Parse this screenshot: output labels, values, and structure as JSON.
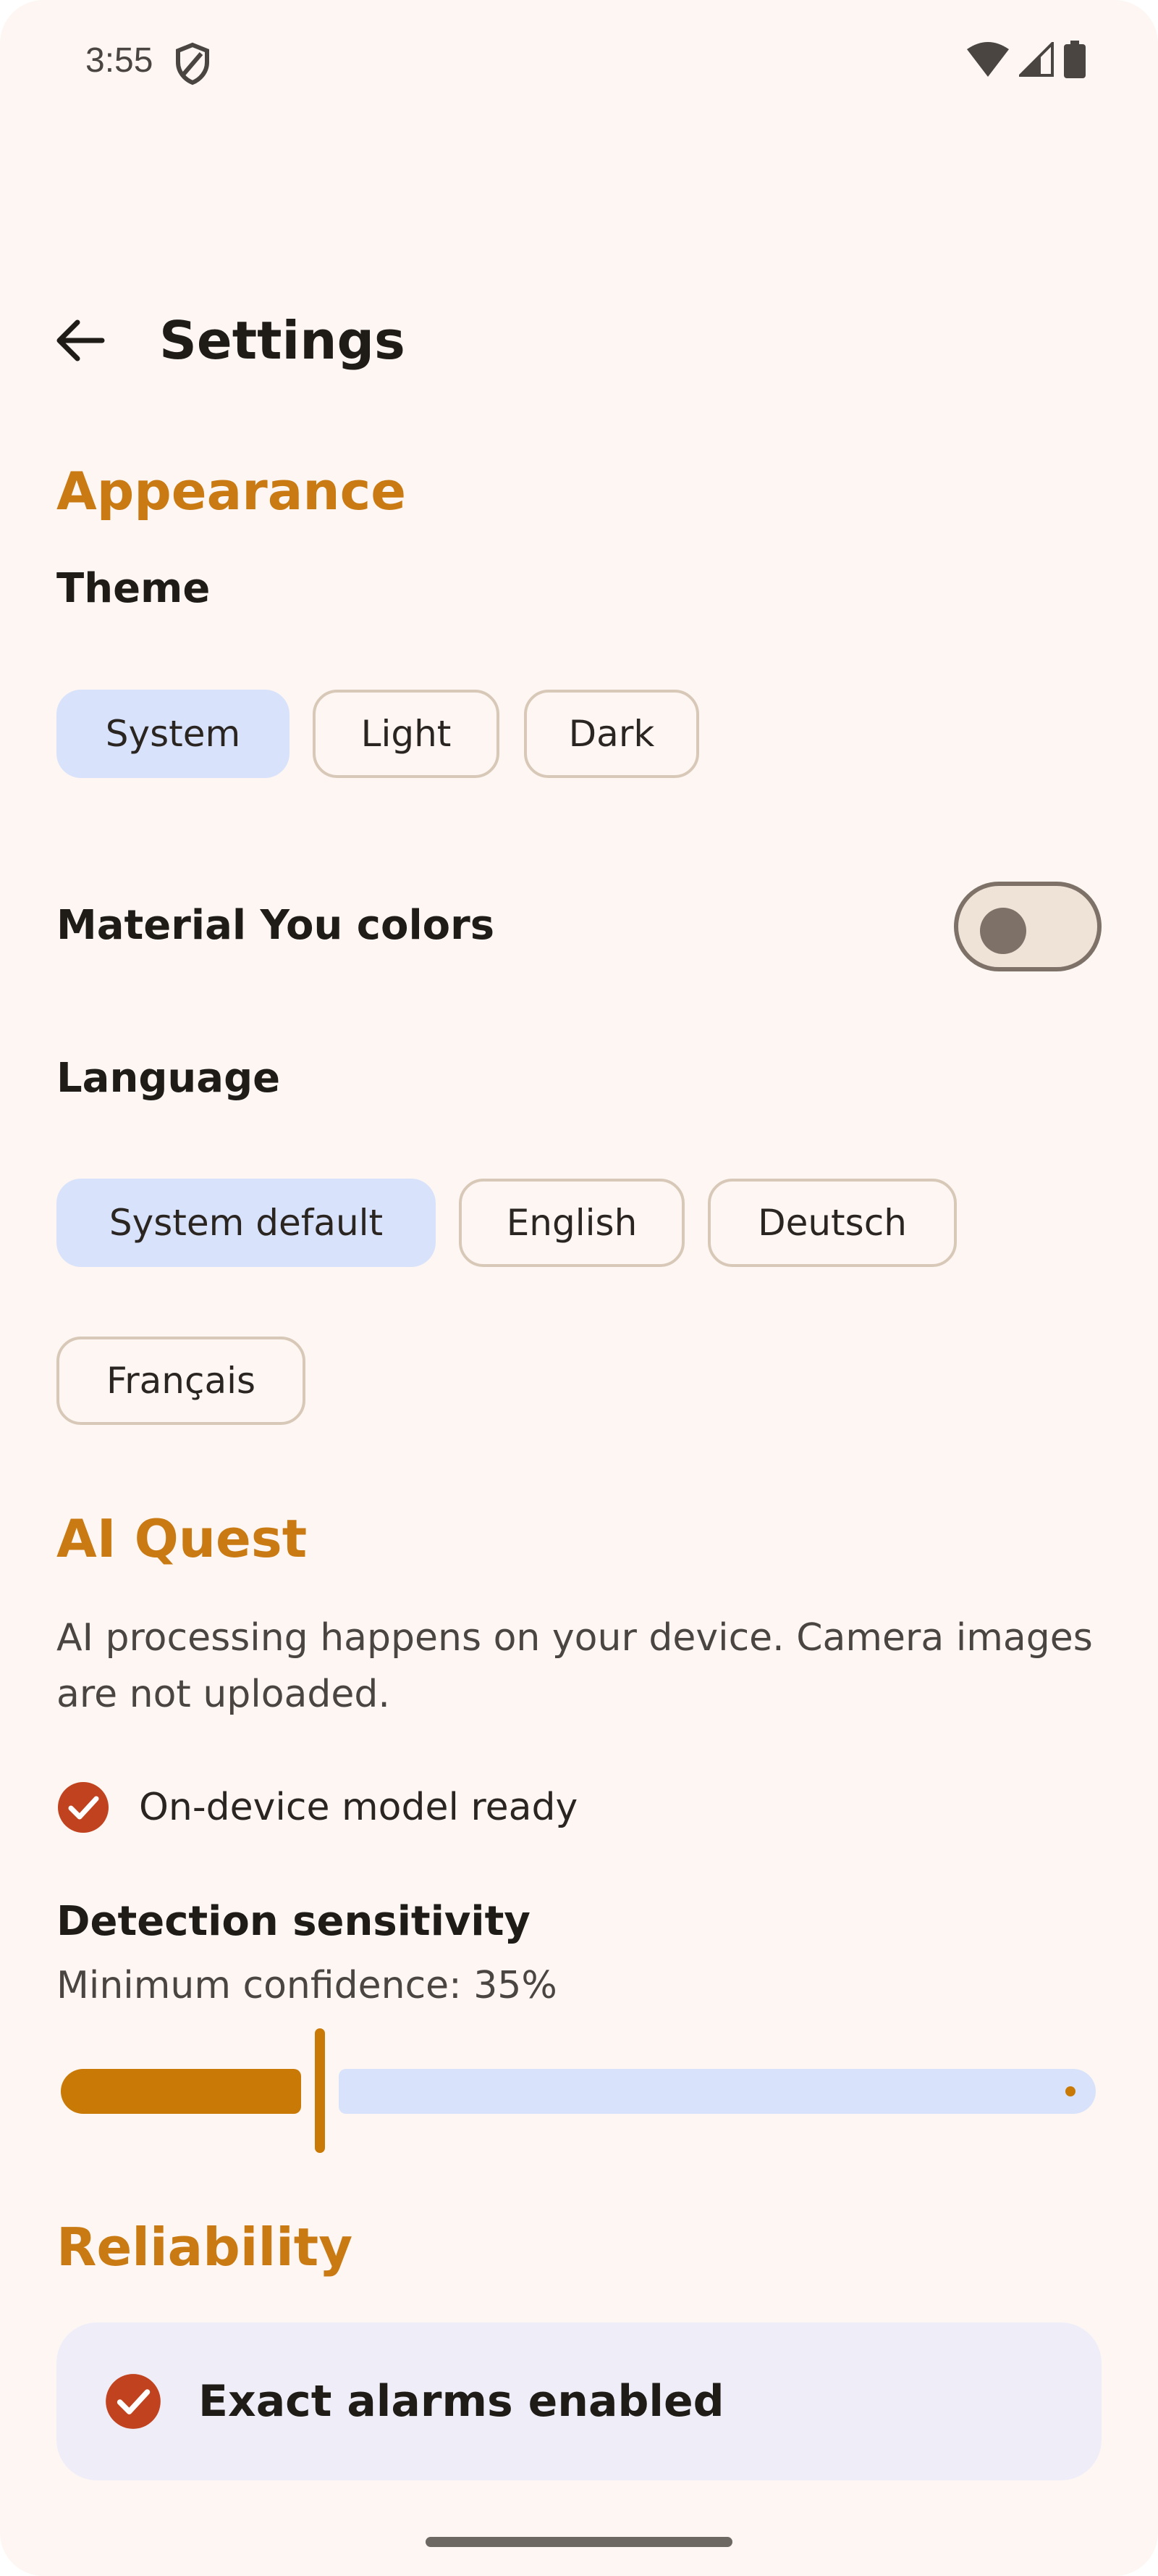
{
  "status_bar": {
    "time": "3:55",
    "left_icon": "shield-icon",
    "right_icons": [
      "wifi-icon",
      "cellular-signal-icon",
      "battery-icon"
    ]
  },
  "header": {
    "back_icon": "arrow-back-icon",
    "title": "Settings"
  },
  "appearance": {
    "section_title": "Appearance",
    "theme": {
      "label": "Theme",
      "options": [
        "System",
        "Light",
        "Dark"
      ],
      "selected": "System"
    },
    "material_you": {
      "label": "Material You colors",
      "enabled": false
    },
    "language": {
      "label": "Language",
      "options": [
        "System default",
        "English",
        "Deutsch",
        "Français"
      ],
      "selected": "System default"
    }
  },
  "ai_quest": {
    "section_title": "AI Quest",
    "description": "AI processing happens on your device. Camera images are not uploaded.",
    "model_status": "On-device model ready",
    "model_status_icon": "check-circle-icon",
    "sensitivity": {
      "label": "Detection sensitivity",
      "value_text": "Minimum confidence: 35%",
      "value": 0.25
    }
  },
  "reliability": {
    "section_title": "Reliability",
    "card_icon": "check-circle-icon",
    "card_text": "Exact alarms enabled"
  },
  "colors": {
    "accent": "#c97a12",
    "background": "#fdf6f2",
    "chip_selected": "#d8e3fb",
    "check": "#c0421e",
    "card": "#efeef8"
  }
}
